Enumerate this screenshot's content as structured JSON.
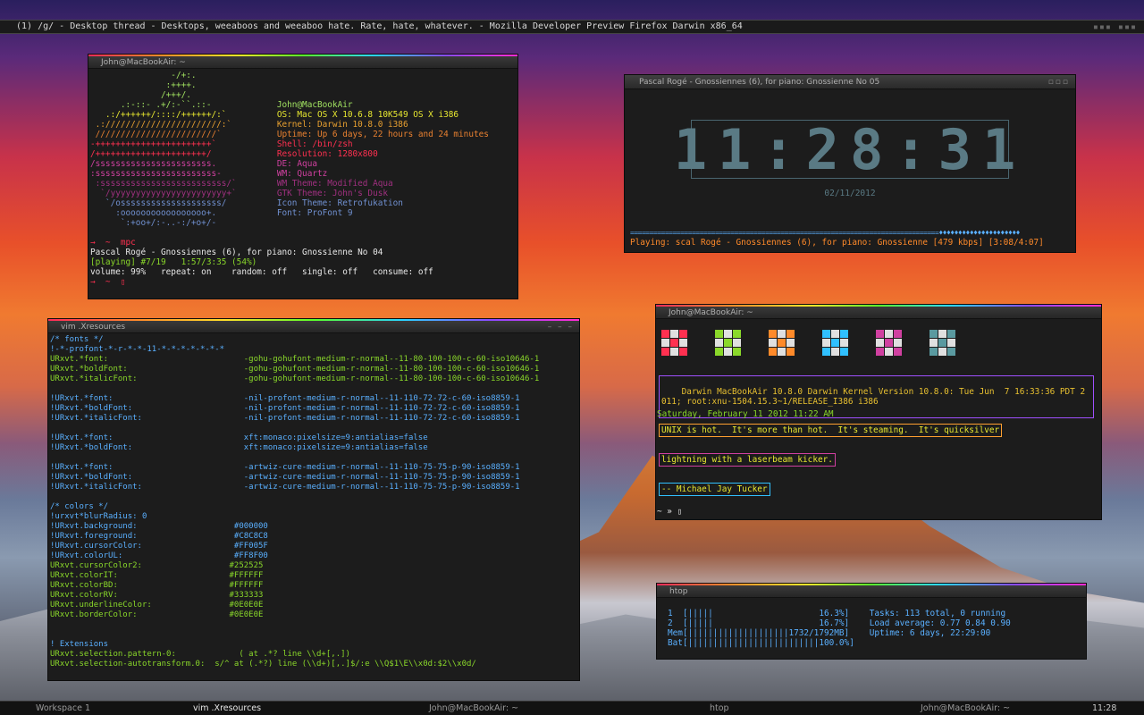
{
  "browser_title": "(1) /g/ - Desktop thread - Desktops, weeaboos and weeaboo hate. Rate, hate, whatever. - Mozilla Developer Preview Firefox Darwin x86_64",
  "topbar_glyphs": "▪▪▪ ▪▪▪",
  "win1": {
    "title": "John@MacBookAir: ~"
  },
  "win2": {
    "title": "Pascal Rogé - Gnossiennes (6), for piano: Gnossienne No 05",
    "clock": "11:28:31",
    "date": "02/11/2012",
    "progress": "================================================================================♦♦♦♦♦♦♦♦♦♦♦♦♦♦♦♦♦♦♦♦♦",
    "status": "Playing: scal Rogé - Gnossiennes (6), for piano: Gnossienne [479 kbps] [3:08/4:07]"
  },
  "win3": {
    "title": "vim .Xresources"
  },
  "win4": {
    "title": "John@MacBookAir: ~",
    "uname": "Darwin MacBookAir 10.8.0 Darwin Kernel Version 10.8.0: Tue Jun  7 16:33:36 PDT 2\n011; root:xnu-1504.15.3~1/RELEASE_I386 i386",
    "date": "Saturday, February 11 2012 11:22 AM",
    "quote1": "UNIX is hot.  It's more than hot.  It's steaming.  It's quicksilver",
    "quote2": "lightning with a laserbeam kicker.",
    "quote3": "-- Michael Jay Tucker",
    "prompt": "~ » ▯"
  },
  "win5": {
    "title": "htop"
  },
  "taskbar": {
    "workspace": "Workspace 1",
    "t1": "vim .Xresources",
    "t2": "John@MacBookAir: ~",
    "t3": "htop",
    "t4": "John@MacBookAir: ~",
    "clock": "11:28"
  },
  "colors": {
    "accent_pink": "#ff2a5a",
    "green": "#8ad82a",
    "blue": "#5ab0ff",
    "orange": "#ff8a2a"
  },
  "lines": {
    "w1": [
      [
        "#a0e060",
        "                -/+:."
      ],
      [
        "#a0e060",
        "               :++++."
      ],
      [
        "#a0e060",
        "              /+++/."
      ],
      [
        "#a0e060",
        "      .:-::- .+/:-``.::-             John@MacBookAir"
      ],
      [
        "#e8e830",
        "   .:/++++++/::::/++++++/:`          OS: Mac OS X 10.6.8 10K549 OS X i386"
      ],
      [
        "#e8a030",
        " .:///////////////////////:`         Kernel: Darwin 10.8.0 i386"
      ],
      [
        "#e88030",
        " ////////////////////////`           Uptime: Up 6 days, 22 hours and 24 minutes"
      ],
      [
        "#ff3050",
        "-+++++++++++++++++++++++`            Shell: /bin/zsh"
      ],
      [
        "#ff3050",
        "/++++++++++++++++++++++/             Resolution: 1280x800"
      ],
      [
        "#d040a0",
        "/sssssssssssssssssssssss.            DE: Aqua"
      ],
      [
        "#d040a0",
        ":ssssssssssssssssssssssss-           WM: Quartz"
      ],
      [
        "#a03080",
        " :sssssssssssssssssssssssss/`        WM Theme: Modified Aqua"
      ],
      [
        "#a03080",
        "  `/yyyyyyyyyyyyyyyyyyyyyyy+`        GTK Theme: John's Dusk"
      ],
      [
        "#7090d0",
        "   `/ossssssssssssssssssss/          Icon Theme: Retrofukation"
      ],
      [
        "#7090d0",
        "     :ooooooooooooooooo+.            Font: ProFont 9"
      ],
      [
        "#7090d0",
        "      `:+oo+/:-..-:/+o+/-"
      ],
      [
        "#c8c8c8",
        " "
      ],
      [
        "#ff3050",
        "→  ~  mpc"
      ],
      [
        "#e8e8e8",
        "Pascal Rogé - Gnossiennes (6), for piano: Gnossienne No 04"
      ],
      [
        "#8ad82a",
        "[playing] #7/19   1:57/3:35 (54%)"
      ],
      [
        "#e8e8e8",
        "volume: 99%   repeat: on    random: off   single: off   consume: off"
      ],
      [
        "#ff3050",
        "→  ~  ▯"
      ]
    ],
    "w3": [
      [
        "#5ab0ff",
        "/* fonts */"
      ],
      [
        "#5ab0ff",
        "!-*-profont-*-r-*-*-11-*-*-*-*-*-*-*"
      ],
      [
        "#8ad82a",
        "URxvt.*font:                            -gohu-gohufont-medium-r-normal--11-80-100-100-c-60-iso10646-1"
      ],
      [
        "#8ad82a",
        "URxvt.*boldFont:                        -gohu-gohufont-medium-r-normal--11-80-100-100-c-60-iso10646-1"
      ],
      [
        "#8ad82a",
        "URxvt.*italicFont:                      -gohu-gohufont-medium-r-normal--11-80-100-100-c-60-iso10646-1"
      ],
      [
        "#c8c8c8",
        " "
      ],
      [
        "#5ab0ff",
        "!URxvt.*font:                           -nil-profont-medium-r-normal--11-110-72-72-c-60-iso8859-1"
      ],
      [
        "#5ab0ff",
        "!URxvt.*boldFont:                       -nil-profont-medium-r-normal--11-110-72-72-c-60-iso8859-1"
      ],
      [
        "#5ab0ff",
        "!URxvt.*italicFont:                     -nil-profont-medium-r-normal--11-110-72-72-c-60-iso8859-1"
      ],
      [
        "#c8c8c8",
        " "
      ],
      [
        "#5ab0ff",
        "!URxvt.*font:                           xft:monaco:pixelsize=9:antialias=false"
      ],
      [
        "#5ab0ff",
        "!URxvt.*boldFont:                       xft:monaco:pixelsize=9:antialias=false"
      ],
      [
        "#c8c8c8",
        " "
      ],
      [
        "#5ab0ff",
        "!URxvt.*font:                           -artwiz-cure-medium-r-normal--11-110-75-75-p-90-iso8859-1"
      ],
      [
        "#5ab0ff",
        "!URxvt.*boldFont:                       -artwiz-cure-medium-r-normal--11-110-75-75-p-90-iso8859-1"
      ],
      [
        "#5ab0ff",
        "!URxvt.*italicFont:                     -artwiz-cure-medium-r-normal--11-110-75-75-p-90-iso8859-1"
      ],
      [
        "#c8c8c8",
        " "
      ],
      [
        "#5ab0ff",
        "/* colors */"
      ],
      [
        "#5ab0ff",
        "!urxvt*blurRadius: 0"
      ],
      [
        "#5ab0ff",
        "!URxvt.background:                    #000000"
      ],
      [
        "#5ab0ff",
        "!URxvt.foreground:                    #C8C8C8"
      ],
      [
        "#5ab0ff",
        "!URxvt.cursorColor:                   #FF005F"
      ],
      [
        "#5ab0ff",
        "!URxvt.colorUL:                       #FF8F00"
      ],
      [
        "#8ad82a",
        "URxvt.cursorColor2:                  #252525"
      ],
      [
        "#8ad82a",
        "URxvt.colorIT:                       #FFFFFF"
      ],
      [
        "#8ad82a",
        "URxvt.colorBD:                       #FFFFFF"
      ],
      [
        "#8ad82a",
        "URxvt.colorRV:                       #333333"
      ],
      [
        "#8ad82a",
        "URxvt.underlineColor:                #0E0E0E"
      ],
      [
        "#8ad82a",
        "URxvt.borderColor:                   #0E0E0E"
      ],
      [
        "#c8c8c8",
        " "
      ],
      [
        "#c8c8c8",
        " "
      ],
      [
        "#5ab0ff",
        "! Extensions"
      ],
      [
        "#8ad82a",
        "URxvt.selection.pattern-0:             ( at .*? line \\\\d+[,.])"
      ],
      [
        "#8ad82a",
        "URxvt.selection-autotransform.0:  s/^ at (.*?) line (\\\\d+)[,.]$/:e \\\\Q$1\\E\\\\x0d:$2\\\\x0d/"
      ]
    ],
    "w5": [
      [
        "#5ab0ff",
        "1  [|||||                     16.3%]    Tasks: 113 total, 0 running"
      ],
      [
        "#5ab0ff",
        "2  [|||||                     16.7%]    Load average: 0.77 0.84 0.90"
      ],
      [
        "#5ab0ff",
        "Mem[||||||||||||||||||||1732/1792MB]    Uptime: 6 days, 22:29:00"
      ],
      [
        "#5ab0ff",
        "Bat[||||||||||||||||||||||||||100.0%]"
      ]
    ]
  }
}
